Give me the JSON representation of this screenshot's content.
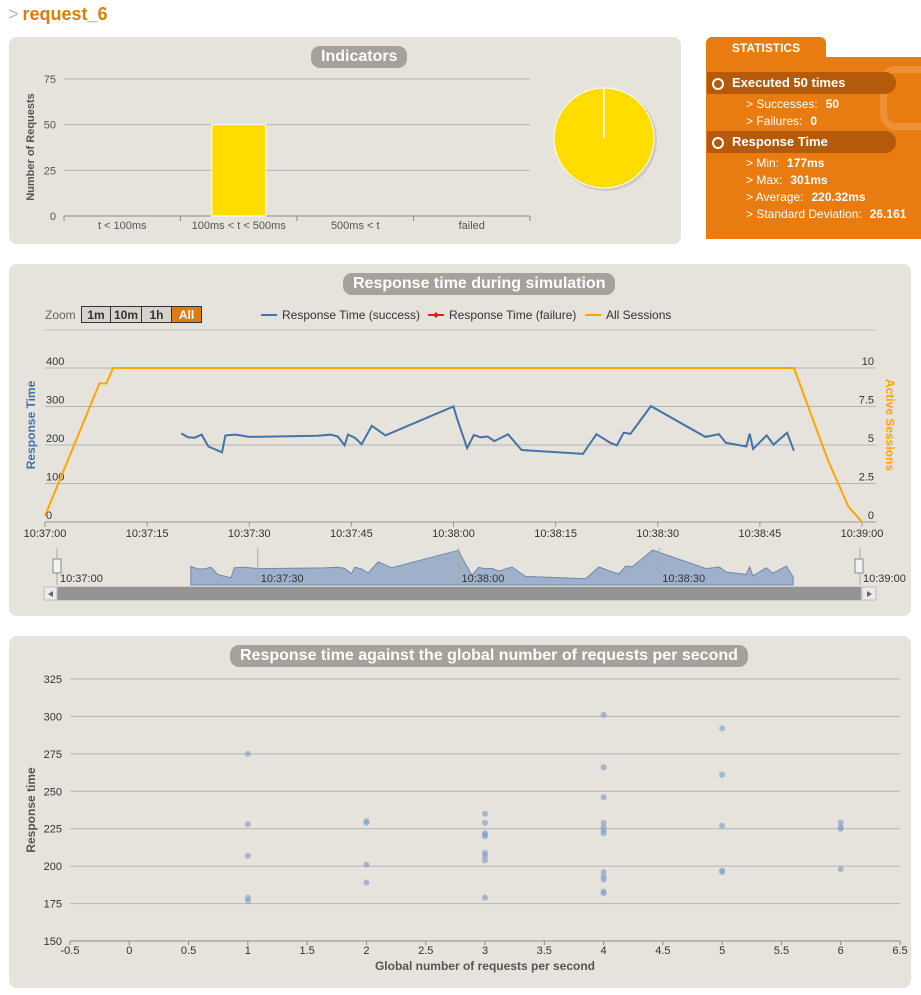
{
  "page": {
    "prefix": ">",
    "title": "request_6"
  },
  "indicators": {
    "title": "Indicators",
    "ylabel": "Number of Requests",
    "yticks": [
      "75",
      "50",
      "25",
      "0"
    ],
    "categories": [
      "t < 100ms",
      "100ms < t < 500ms",
      "500ms < t",
      "failed"
    ],
    "values": [
      0,
      50,
      0,
      0
    ],
    "pie_color": "#FFDD00"
  },
  "stats": {
    "tab": "STATISTICS",
    "executed": "Executed 50 times",
    "successes_label": "> Successes:",
    "successes_value": "50",
    "failures_label": "> Failures:",
    "failures_value": "0",
    "response_header": "Response Time",
    "min_label": "> Min:",
    "min_value": "177ms",
    "max_label": "> Max:",
    "max_value": "301ms",
    "avg_label": "> Average:",
    "avg_value": "220.32ms",
    "sd_label": "> Standard Deviation:",
    "sd_value": "26.161"
  },
  "simulation": {
    "title": "Response time during simulation",
    "zoom_label": "Zoom",
    "zoom_buttons": [
      "1m",
      "10m",
      "1h",
      "All"
    ],
    "legend": [
      "Response Time (success)",
      "Response Time (failure)",
      "All Sessions"
    ],
    "ylabel_left": "Response Time",
    "ylabel_right": "Active Sessions",
    "yticks_left": [
      "400",
      "300",
      "200",
      "100",
      "0"
    ],
    "yticks_right": [
      "10",
      "7.5",
      "5",
      "2.5",
      "0"
    ],
    "xticks": [
      "10:37:00",
      "10:37:15",
      "10:37:30",
      "10:37:45",
      "10:38:00",
      "10:38:15",
      "10:38:30",
      "10:38:45",
      "10:39:00"
    ],
    "navigator_ticks": [
      "10:37:00",
      "10:37:30",
      "10:38:00",
      "10:38:30",
      "10:39:00"
    ]
  },
  "scatter": {
    "title": "Response time against the global number of requests per second",
    "xlabel": "Global number of requests per second",
    "ylabel": "Response time",
    "xticks": [
      "-0.5",
      "0",
      "0.5",
      "1",
      "1.5",
      "2",
      "2.5",
      "3",
      "3.5",
      "4",
      "4.5",
      "5",
      "5.5",
      "6",
      "6.5"
    ],
    "yticks": [
      "325",
      "300",
      "275",
      "250",
      "225",
      "200",
      "175",
      "150"
    ]
  },
  "colors": {
    "accent": "#e07b0f",
    "success": "#4572a7",
    "failure": "#e0201f",
    "sessions": "#ffa500",
    "bar": "#FFDD00"
  },
  "chart_data": [
    {
      "type": "bar",
      "title": "Indicators",
      "categories": [
        "t < 100ms",
        "100ms < t < 500ms",
        "500ms < t",
        "failed"
      ],
      "values": [
        0,
        50,
        0,
        0
      ],
      "ylabel": "Number of Requests",
      "ylim": [
        0,
        75
      ]
    },
    {
      "type": "pie",
      "categories": [
        "t < 100ms",
        "100ms < t < 500ms",
        "500ms < t",
        "failed"
      ],
      "values": [
        0,
        50,
        0,
        0
      ]
    },
    {
      "type": "line",
      "title": "Response time during simulation",
      "xlabel": "",
      "ylabel": "Response Time",
      "ylim": [
        0,
        400
      ],
      "y2label": "Active Sessions",
      "y2lim": [
        0,
        10
      ],
      "xlim": [
        "10:37:00",
        "10:39:00"
      ],
      "series": [
        {
          "name": "Response Time (success)",
          "axis": "left",
          "points": [
            [
              "10:37:20",
              230
            ],
            [
              "10:37:21",
              220
            ],
            [
              "10:37:22",
              219
            ],
            [
              "10:37:23",
              227
            ],
            [
              "10:37:24",
              196
            ],
            [
              "10:37:26",
              181
            ],
            [
              "10:37:26.5",
              225
            ],
            [
              "10:37:28",
              227
            ],
            [
              "10:37:30",
              221
            ],
            [
              "10:37:40",
              224
            ],
            [
              "10:37:42",
              227
            ],
            [
              "10:37:43",
              222
            ],
            [
              "10:37:44",
              199
            ],
            [
              "10:37:44.5",
              227
            ],
            [
              "10:37:45.5",
              219
            ],
            [
              "10:37:46.5",
              202
            ],
            [
              "10:37:48",
              250
            ],
            [
              "10:37:50",
              225
            ],
            [
              "10:38:00",
              300
            ],
            [
              "10:38:00.5",
              270
            ],
            [
              "10:38:02",
              192
            ],
            [
              "10:38:03",
              226
            ],
            [
              "10:38:04",
              220
            ],
            [
              "10:38:05",
              222
            ],
            [
              "10:38:06",
              210
            ],
            [
              "10:38:08",
              228
            ],
            [
              "10:38:10",
              187
            ],
            [
              "10:38:19",
              177
            ],
            [
              "10:38:21",
              228
            ],
            [
              "10:38:23",
              206
            ],
            [
              "10:38:24",
              199
            ],
            [
              "10:38:25",
              232
            ],
            [
              "10:38:26",
              229
            ],
            [
              "10:38:29",
              301
            ],
            [
              "10:38:37",
              221
            ],
            [
              "10:38:39",
              228
            ],
            [
              "10:38:40",
              206
            ],
            [
              "10:38:43",
              196
            ],
            [
              "10:38:43.5",
              229
            ],
            [
              "10:38:44",
              190
            ],
            [
              "10:38:46",
              225
            ],
            [
              "10:38:47",
              201
            ],
            [
              "10:38:49",
              232
            ],
            [
              "10:38:50",
              185
            ]
          ]
        },
        {
          "name": "Response Time (failure)",
          "axis": "left",
          "points": []
        },
        {
          "name": "All Sessions",
          "axis": "right",
          "points": [
            [
              "10:37:00",
              0.4
            ],
            [
              "10:37:08",
              9
            ],
            [
              "10:37:09",
              9
            ],
            [
              "10:37:10",
              10
            ],
            [
              "10:38:50",
              10
            ],
            [
              "10:38:55",
              4
            ],
            [
              "10:38:58",
              1
            ],
            [
              "10:39:00",
              0
            ]
          ]
        }
      ]
    },
    {
      "type": "scatter",
      "title": "Response time against the global number of requests per second",
      "xlabel": "Global number of requests per second",
      "ylabel": "Response time",
      "xlim": [
        -0.5,
        6.5
      ],
      "ylim": [
        150,
        325
      ],
      "series": [
        {
          "points": [
            [
              1,
              275
            ],
            [
              1,
              228
            ],
            [
              1,
              207
            ],
            [
              1,
              179
            ],
            [
              1,
              177
            ],
            [
              2,
              230
            ],
            [
              2,
              229
            ],
            [
              2,
              201
            ],
            [
              2,
              189
            ],
            [
              3,
              235
            ],
            [
              3,
              229
            ],
            [
              3,
              222
            ],
            [
              3,
              221
            ],
            [
              3,
              220
            ],
            [
              3,
              209
            ],
            [
              3,
              207
            ],
            [
              3,
              204
            ],
            [
              3,
              179
            ],
            [
              4,
              301
            ],
            [
              4,
              266
            ],
            [
              4,
              246
            ],
            [
              4,
              229
            ],
            [
              4,
              226
            ],
            [
              4,
              224
            ],
            [
              4,
              222
            ],
            [
              4,
              196
            ],
            [
              4,
              193
            ],
            [
              4,
              191
            ],
            [
              4,
              183
            ],
            [
              4,
              182
            ],
            [
              5,
              292
            ],
            [
              5,
              261
            ],
            [
              5,
              227
            ],
            [
              5,
              197
            ],
            [
              5,
              196
            ],
            [
              6,
              229
            ],
            [
              6,
              226
            ],
            [
              6,
              225
            ],
            [
              6,
              198
            ]
          ]
        }
      ]
    }
  ]
}
